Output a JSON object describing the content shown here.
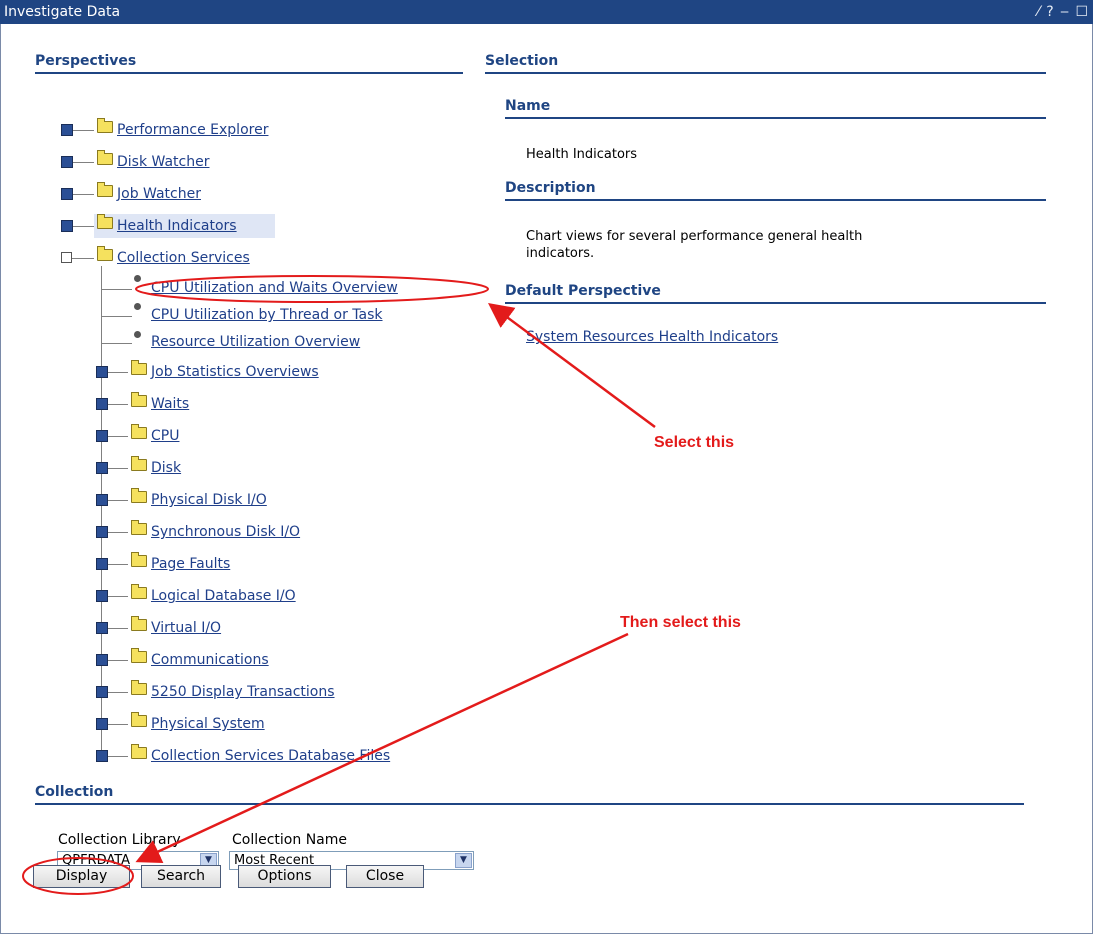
{
  "window": {
    "title": "Investigate Data",
    "controls": "⁄ ? ‒ ☐"
  },
  "perspectives": {
    "heading": "Perspectives",
    "top_items": [
      {
        "label": "Performance Explorer"
      },
      {
        "label": "Disk Watcher"
      },
      {
        "label": "Job Watcher"
      },
      {
        "label": "Health Indicators"
      },
      {
        "label": "Collection Services"
      }
    ],
    "collection_services_leaves": [
      {
        "label": "CPU Utilization and Waits Overview"
      },
      {
        "label": "CPU Utilization by Thread or Task"
      },
      {
        "label": "Resource Utilization Overview"
      }
    ],
    "collection_services_folders": [
      {
        "label": "Job Statistics Overviews"
      },
      {
        "label": "Waits"
      },
      {
        "label": "CPU"
      },
      {
        "label": "Disk"
      },
      {
        "label": "Physical Disk I/O"
      },
      {
        "label": "Synchronous Disk I/O"
      },
      {
        "label": "Page Faults"
      },
      {
        "label": "Logical Database I/O"
      },
      {
        "label": "Virtual I/O"
      },
      {
        "label": "Communications"
      },
      {
        "label": "5250 Display Transactions"
      },
      {
        "label": "Physical System"
      },
      {
        "label": "Collection Services Database Files"
      }
    ]
  },
  "selection": {
    "heading": "Selection",
    "name_heading": "Name",
    "name_value": "Health Indicators",
    "description_heading": "Description",
    "description_line1": "Chart views for several performance general health",
    "description_line2": "indicators.",
    "default_heading": "Default Perspective",
    "default_link": "System Resources Health Indicators"
  },
  "collection": {
    "heading": "Collection",
    "library_label": "Collection Library",
    "library_value": "QPFRDATA",
    "name_label": "Collection Name",
    "name_value": "Most Recent"
  },
  "buttons": {
    "display": "Display",
    "search": "Search",
    "options": "Options",
    "close": "Close"
  },
  "annotations": {
    "select_this": "Select this",
    "then_select_this": "Then select this",
    "color": "#e31b1b"
  },
  "colors": {
    "title_bar": "#1f4583",
    "heading": "#1f4583",
    "link": "#1f3f8a",
    "highlight": "#dfe6f5"
  }
}
